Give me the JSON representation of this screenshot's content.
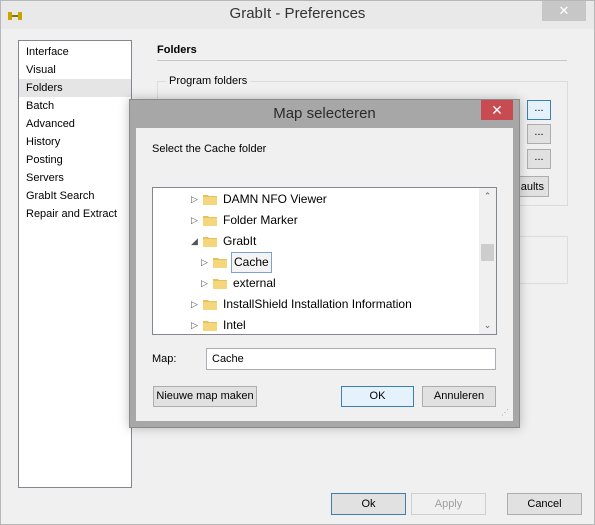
{
  "window": {
    "title": "GrabIt - Preferences",
    "close_glyph": "✕"
  },
  "sidebar": {
    "items": [
      {
        "label": "Interface"
      },
      {
        "label": "Visual"
      },
      {
        "label": "Folders",
        "selected": true
      },
      {
        "label": "Batch"
      },
      {
        "label": "Advanced"
      },
      {
        "label": "History"
      },
      {
        "label": "Posting"
      },
      {
        "label": "Servers"
      },
      {
        "label": "GrabIt Search"
      },
      {
        "label": "Repair and Extract"
      }
    ]
  },
  "folders": {
    "section_title": "Folders",
    "group_label": "Program folders",
    "browse_label": "...",
    "defaults_label": "aults"
  },
  "footer": {
    "ok_label": "Ok",
    "apply_label": "Apply",
    "cancel_label": "Cancel"
  },
  "dialog": {
    "title": "Map selecteren",
    "close_glyph": "✕",
    "prompt": "Select the Cache folder",
    "tree": [
      {
        "label": "DAMN NFO Viewer",
        "level": 0,
        "expander": "▷"
      },
      {
        "label": "Folder Marker",
        "level": 0,
        "expander": "▷"
      },
      {
        "label": "GrabIt",
        "level": 0,
        "expander": "◢"
      },
      {
        "label": "Cache",
        "level": 1,
        "expander": "▷",
        "selected": true
      },
      {
        "label": "external",
        "level": 1,
        "expander": "▷"
      },
      {
        "label": "InstallShield Installation Information",
        "level": 0,
        "expander": "▷"
      },
      {
        "label": "Intel",
        "level": 0,
        "expander": "▷"
      }
    ],
    "map_label": "Map:",
    "map_value": "Cache",
    "new_folder_label": "Nieuwe map maken",
    "ok_label": "OK",
    "cancel_label": "Annuleren"
  }
}
